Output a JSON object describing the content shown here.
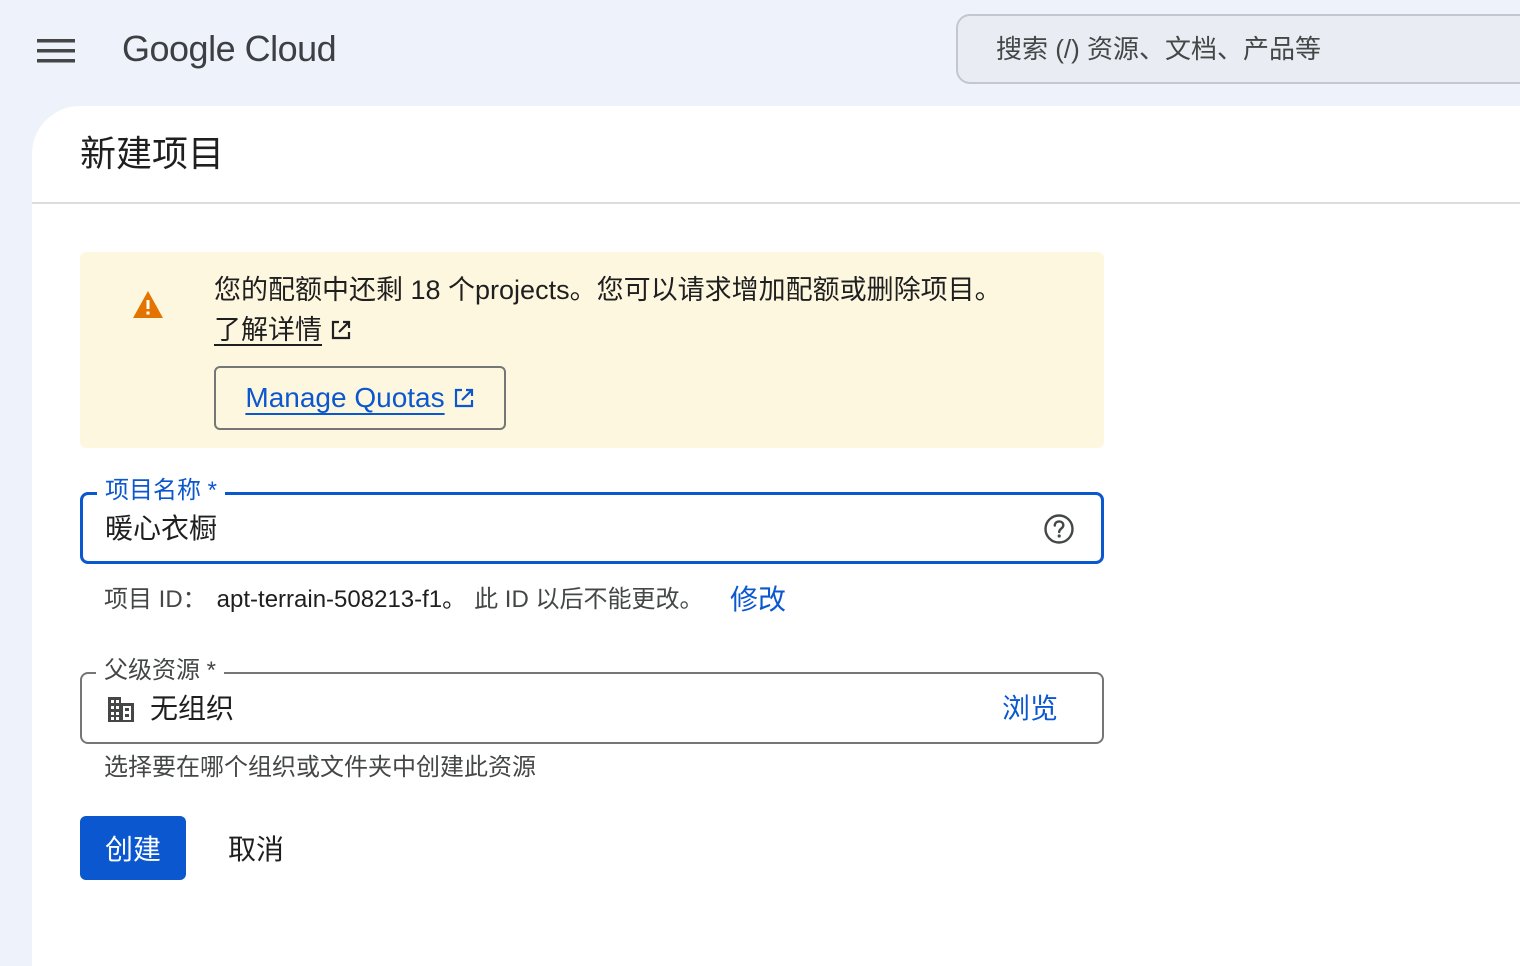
{
  "header": {
    "logo_text": "Google Cloud",
    "search_placeholder": "搜索 (/) 资源、文档、产品等"
  },
  "page": {
    "title": "新建项目"
  },
  "quota_notice": {
    "message": "您的配额中还剩 18 个projects。您可以请求增加配额或删除项目。",
    "learn_more": "了解详情",
    "manage_button": "Manage Quotas",
    "icon": "warning-icon",
    "background_color": "#fef7e0",
    "icon_color": "#e37400"
  },
  "project_name": {
    "label": "项目名称 *",
    "value": "暖心衣橱",
    "help_icon": "help-circle-icon"
  },
  "project_id": {
    "prefix": "项目 ID：",
    "value": "apt-terrain-508213-f1。",
    "note": "此 ID 以后不能更改。",
    "edit_label": "修改"
  },
  "parent_resource": {
    "label": "父级资源 *",
    "value": "无组织",
    "icon": "organization-building-icon",
    "browse_label": "浏览",
    "hint": "选择要在哪个组织或文件夹中创建此资源"
  },
  "actions": {
    "create_label": "创建",
    "cancel_label": "取消"
  },
  "colors": {
    "primary": "#0b57d0",
    "background": "#eef2fb"
  }
}
